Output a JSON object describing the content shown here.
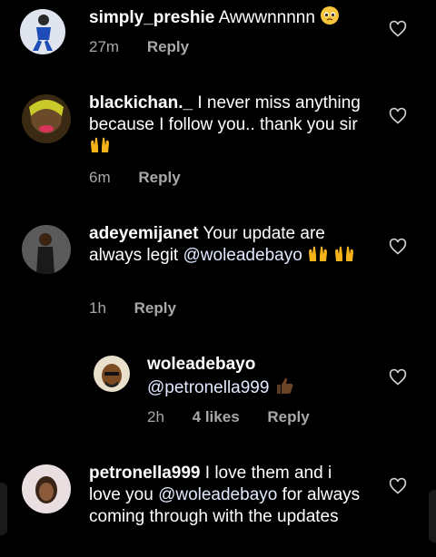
{
  "comments": [
    {
      "username": "simply_preshie",
      "text": "Awwwnnnnn",
      "emoji": "pleading-face",
      "time": "27m",
      "reply": "Reply"
    },
    {
      "username": "blackichan._",
      "text": "I never miss anything because I follow you.. thank you sir",
      "emoji": "raising-hands",
      "time": "6m",
      "reply": "Reply"
    },
    {
      "username": "adeyemijanet",
      "text": "Your update are always legit",
      "mention": "@woleadebayo",
      "emoji": "raising-hands",
      "time": "1h",
      "reply": "Reply"
    },
    {
      "username": "woleadebayo",
      "mention": "@petronella999",
      "emoji": "thumbs-up",
      "time": "2h",
      "likes": "4 likes",
      "reply": "Reply"
    },
    {
      "username": "petronella999",
      "text_before": "I love them and i love you",
      "mention": "@woleadebayo",
      "text_after": "for always coming through with the updates"
    }
  ]
}
